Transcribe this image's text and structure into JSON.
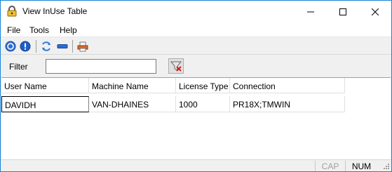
{
  "window": {
    "title": "View InUse Table"
  },
  "menu": [
    {
      "label": "File"
    },
    {
      "label": "Tools"
    },
    {
      "label": "Help"
    }
  ],
  "toolbar": {
    "buttons": [
      {
        "icon": "help-icon"
      },
      {
        "icon": "info-icon"
      },
      {
        "icon": "refresh-icon"
      },
      {
        "icon": "remove-icon"
      },
      {
        "icon": "print-icon"
      }
    ]
  },
  "filter": {
    "label": "Filter",
    "value": ""
  },
  "table": {
    "columns": [
      "User Name",
      "Machine Name",
      "License Type",
      "Connection"
    ],
    "rows": [
      [
        "DAVIDH",
        "VAN-DHAINES",
        "1000",
        "PR18X;TMWIN"
      ]
    ]
  },
  "statusbar": {
    "cap": "CAP",
    "num": "NUM"
  },
  "colors": {
    "accent": "#1883d7",
    "window_bg": "#f0f0f0"
  }
}
